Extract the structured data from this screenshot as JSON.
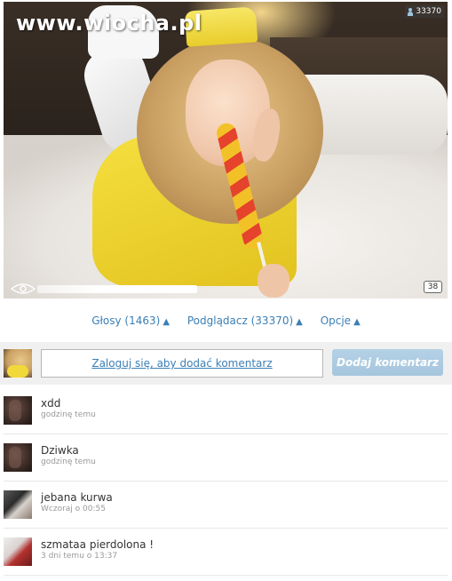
{
  "photo": {
    "watermark": "www.wiocha.pl",
    "view_count": "33370",
    "comment_count": "38"
  },
  "actions": [
    {
      "label": "Głosy (1463)",
      "arrow": "▲"
    },
    {
      "label": "Podglądacz (33370)",
      "arrow": "▲"
    },
    {
      "label": "Opcje",
      "arrow": "▲"
    }
  ],
  "comment_bar": {
    "login_text": "Zaloguj się, aby dodać komentarz",
    "add_button": "Dodaj komentarz"
  },
  "comments": [
    {
      "text": "xdd",
      "time": "godzinę temu"
    },
    {
      "text": "Dziwka",
      "time": "godzinę temu"
    },
    {
      "text": "jebana kurwa",
      "time": "Wczoraj o 00:55"
    },
    {
      "text": "szmataa pierdolona !",
      "time": "3 dni temu o 13:37"
    }
  ],
  "colors": {
    "link": "#3b7fb6",
    "button": "#a6c6dd",
    "bar_bg": "#f0f0f0"
  }
}
